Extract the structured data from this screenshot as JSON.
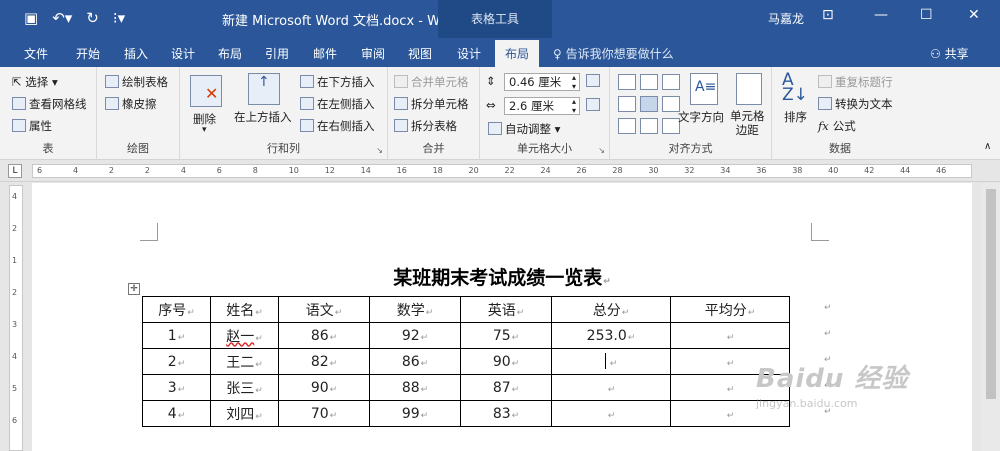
{
  "titlebar": {
    "document_title": "新建 Microsoft Word 文档.docx - Word",
    "context_tab_group": "表格工具",
    "user": "马嘉龙"
  },
  "tabs": [
    {
      "label": "文件"
    },
    {
      "label": "开始"
    },
    {
      "label": "插入"
    },
    {
      "label": "设计"
    },
    {
      "label": "布局"
    },
    {
      "label": "引用"
    },
    {
      "label": "邮件"
    },
    {
      "label": "审阅"
    },
    {
      "label": "视图"
    },
    {
      "label": "设计"
    },
    {
      "label": "布局",
      "active": true
    }
  ],
  "tell_me": "告诉我你想要做什么",
  "share": "共享",
  "ribbon": {
    "table": {
      "label": "表",
      "select": "选择",
      "gridlines": "查看网格线",
      "properties": "属性"
    },
    "draw": {
      "label": "绘图",
      "draw_table": "绘制表格",
      "eraser": "橡皮擦"
    },
    "rows_cols": {
      "label": "行和列",
      "delete": "删除",
      "insert_above": "在上方插入",
      "insert_below": "在下方插入",
      "insert_left": "在左侧插入",
      "insert_right": "在右侧插入"
    },
    "merge": {
      "label": "合并",
      "merge_cells": "合并单元格",
      "split_cells": "拆分单元格",
      "split_table": "拆分表格"
    },
    "cell_size": {
      "label": "单元格大小",
      "height": "0.46 厘米",
      "width": "2.6 厘米",
      "autofit": "自动调整"
    },
    "alignment": {
      "label": "对齐方式",
      "text_direction": "文字方向",
      "cell_margins_line1": "单元格",
      "cell_margins_line2": "边距"
    },
    "data": {
      "label": "数据",
      "sort": "排序",
      "repeat_header": "重复标题行",
      "convert_to_text": "转换为文本",
      "formula": "公式"
    }
  },
  "ruler_marks": [
    "6",
    "4",
    "2",
    "2",
    "4",
    "6",
    "8",
    "10",
    "12",
    "14",
    "16",
    "18",
    "20",
    "22",
    "24",
    "26",
    "28",
    "30",
    "32",
    "34",
    "36",
    "38",
    "40",
    "42",
    "44",
    "46"
  ],
  "vruler_marks": [
    "4",
    "2",
    "1",
    "2",
    "3",
    "4",
    "5",
    "6"
  ],
  "document": {
    "heading": "某班期末考试成绩一览表",
    "table": {
      "headers": [
        "序号",
        "姓名",
        "语文",
        "数学",
        "英语",
        "总分",
        "平均分"
      ],
      "rows": [
        [
          "1",
          "赵一",
          "86",
          "92",
          "75",
          "253.0",
          ""
        ],
        [
          "2",
          "王二",
          "82",
          "86",
          "90",
          "",
          ""
        ],
        [
          "3",
          "张三",
          "90",
          "88",
          "87",
          "",
          ""
        ],
        [
          "4",
          "刘四",
          "70",
          "99",
          "83",
          "",
          ""
        ]
      ]
    }
  },
  "watermark": {
    "brand": "Baidu 经验",
    "url": "jingyan.baidu.com"
  }
}
